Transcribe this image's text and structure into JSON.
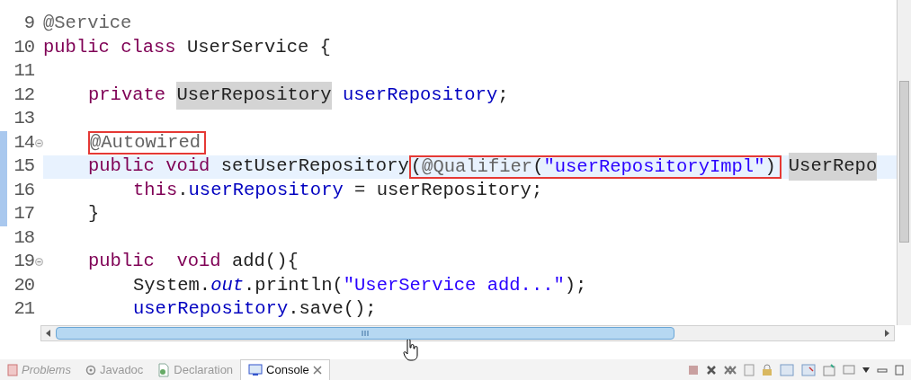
{
  "editor": {
    "lines": [
      {
        "number": "9",
        "kind": "top",
        "tokens": [
          {
            "kind": "annotation",
            "text": "@Service"
          }
        ]
      },
      {
        "number": "10",
        "kind": "top",
        "tokens": [
          {
            "kind": "keyword",
            "text": "public "
          },
          {
            "kind": "keyword",
            "text": "class"
          },
          {
            "kind": "plain",
            "text": " UserService {"
          }
        ]
      },
      {
        "number": "11",
        "kind": "top"
      },
      {
        "number": "12",
        "kind": "member",
        "tokens": [
          {
            "kind": "keyword",
            "text": "private "
          },
          {
            "kind": "marked",
            "text": "UserRepository"
          },
          {
            "kind": "field",
            "text": " userRepository"
          },
          {
            "kind": "plain",
            "text": ";"
          }
        ]
      },
      {
        "number": "13",
        "kind": "top"
      },
      {
        "number": "14",
        "kind": "member",
        "fold": true,
        "changed": true,
        "tokens": [
          {
            "kind": "boxed",
            "parts": [
              {
                "kind": "annotation",
                "text": "@Autowired"
              }
            ]
          }
        ]
      },
      {
        "number": "15",
        "kind": "member",
        "current": true,
        "changed": true,
        "tokens": [
          {
            "kind": "keyword",
            "text": "public "
          },
          {
            "kind": "keyword",
            "text": "void"
          },
          {
            "kind": "plain",
            "text": " setUserRepository"
          },
          {
            "kind": "boxed",
            "parts": [
              {
                "kind": "plain",
                "text": "("
              },
              {
                "kind": "annotation",
                "text": "@Qualifier"
              },
              {
                "kind": "plain",
                "text": "("
              },
              {
                "kind": "string",
                "text": "\"userRepositoryImpl\""
              },
              {
                "kind": "plain",
                "text": ")"
              }
            ]
          },
          {
            "kind": "marked",
            "text": "UserRepo"
          }
        ]
      },
      {
        "number": "16",
        "kind": "body",
        "changed": true,
        "tokens": [
          {
            "kind": "keyword",
            "text": "this"
          },
          {
            "kind": "plain",
            "text": "."
          },
          {
            "kind": "field",
            "text": "userRepository"
          },
          {
            "kind": "plain",
            "text": " = userRepository;"
          }
        ]
      },
      {
        "number": "17",
        "kind": "member",
        "changed": true,
        "tokens": [
          {
            "kind": "plain",
            "text": "}"
          }
        ]
      },
      {
        "number": "18",
        "kind": "top"
      },
      {
        "number": "19",
        "kind": "member",
        "fold": true,
        "tokens": [
          {
            "kind": "keyword",
            "text": "public  "
          },
          {
            "kind": "keyword",
            "text": "void"
          },
          {
            "kind": "plain",
            "text": " add(){"
          }
        ]
      },
      {
        "number": "20",
        "kind": "body",
        "tokens": [
          {
            "kind": "plain",
            "text": "System."
          },
          {
            "kind": "static",
            "text": "out"
          },
          {
            "kind": "plain",
            "text": ".println("
          },
          {
            "kind": "string",
            "text": "\"UserService add...\""
          },
          {
            "kind": "plain",
            "text": ");"
          }
        ]
      },
      {
        "number": "21",
        "kind": "body",
        "tokens": [
          {
            "kind": "field",
            "text": "userRepository"
          },
          {
            "kind": "plain",
            "text": ".save();"
          }
        ]
      }
    ]
  },
  "panel_tabs": [
    {
      "label": "Problems",
      "kind": "problems",
      "selected": false
    },
    {
      "label": "Javadoc",
      "kind": "javadoc",
      "selected": false
    },
    {
      "label": "Declaration",
      "kind": "declaration",
      "selected": false
    },
    {
      "label": "Console",
      "kind": "console",
      "selected": true
    }
  ]
}
